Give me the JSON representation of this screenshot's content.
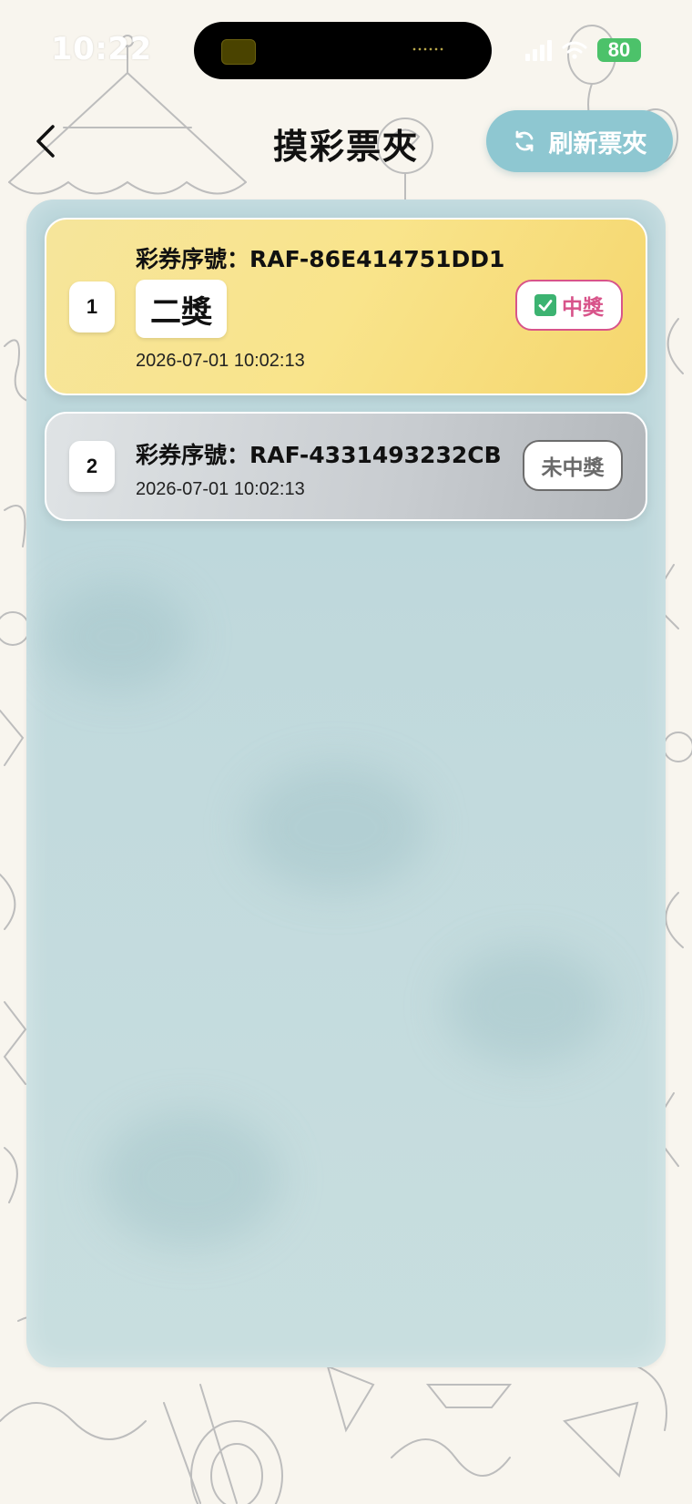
{
  "status_bar": {
    "time": "10:22",
    "battery": "80"
  },
  "header": {
    "title": "摸彩票夾",
    "refresh_label": "刷新票夾"
  },
  "tickets": [
    {
      "index": "1",
      "serial": "彩券序號：RAF-86E414751DD1",
      "prize": "二獎",
      "time": "2026-07-01 10:02:13",
      "status": "中獎"
    },
    {
      "index": "2",
      "serial": "彩券序號：RAF-4331493232CB",
      "time": "2026-07-01 10:02:13",
      "status": "未中獎"
    }
  ],
  "icons": {
    "back": "chevron-left-icon",
    "refresh": "refresh-icon",
    "check": "check-box-icon"
  },
  "colors": {
    "winner_card": "#f7df7e",
    "loser_card": "#c8ccd0",
    "refresh_button": "#8ec7d1",
    "win_badge": "#d8548a",
    "panel": "#c0d8dc"
  }
}
